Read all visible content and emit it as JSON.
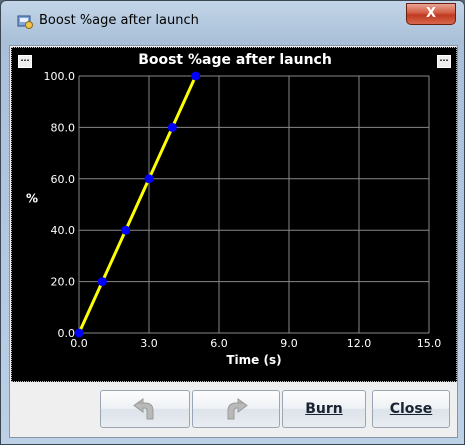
{
  "window": {
    "title": "Boost %age after launch",
    "close_glyph": "X"
  },
  "toolbar": {
    "undo_icon": "undo-arrow-icon",
    "redo_icon": "redo-arrow-icon",
    "burn_label": "Burn",
    "close_label": "Close"
  },
  "panel": {
    "left_menu_glyph": "...",
    "right_menu_glyph": "..."
  },
  "chart_data": {
    "type": "line",
    "title": "Boost %age after launch",
    "xlabel": "Time (s)",
    "ylabel": "%",
    "xlim": [
      0,
      15
    ],
    "ylim": [
      0,
      100
    ],
    "xticks": [
      "0.0",
      "3.0",
      "6.0",
      "9.0",
      "12.0",
      "15.0"
    ],
    "yticks": [
      "0.0",
      "20.0",
      "40.0",
      "60.0",
      "80.0",
      "100.0"
    ],
    "grid": true,
    "series": [
      {
        "x": [
          0,
          1,
          2,
          3,
          4,
          5
        ],
        "y": [
          0,
          20,
          40,
          60,
          80,
          100
        ]
      }
    ],
    "line_color": "#ffff00",
    "point_color": "#0000ff",
    "grid_color": "#888888"
  }
}
